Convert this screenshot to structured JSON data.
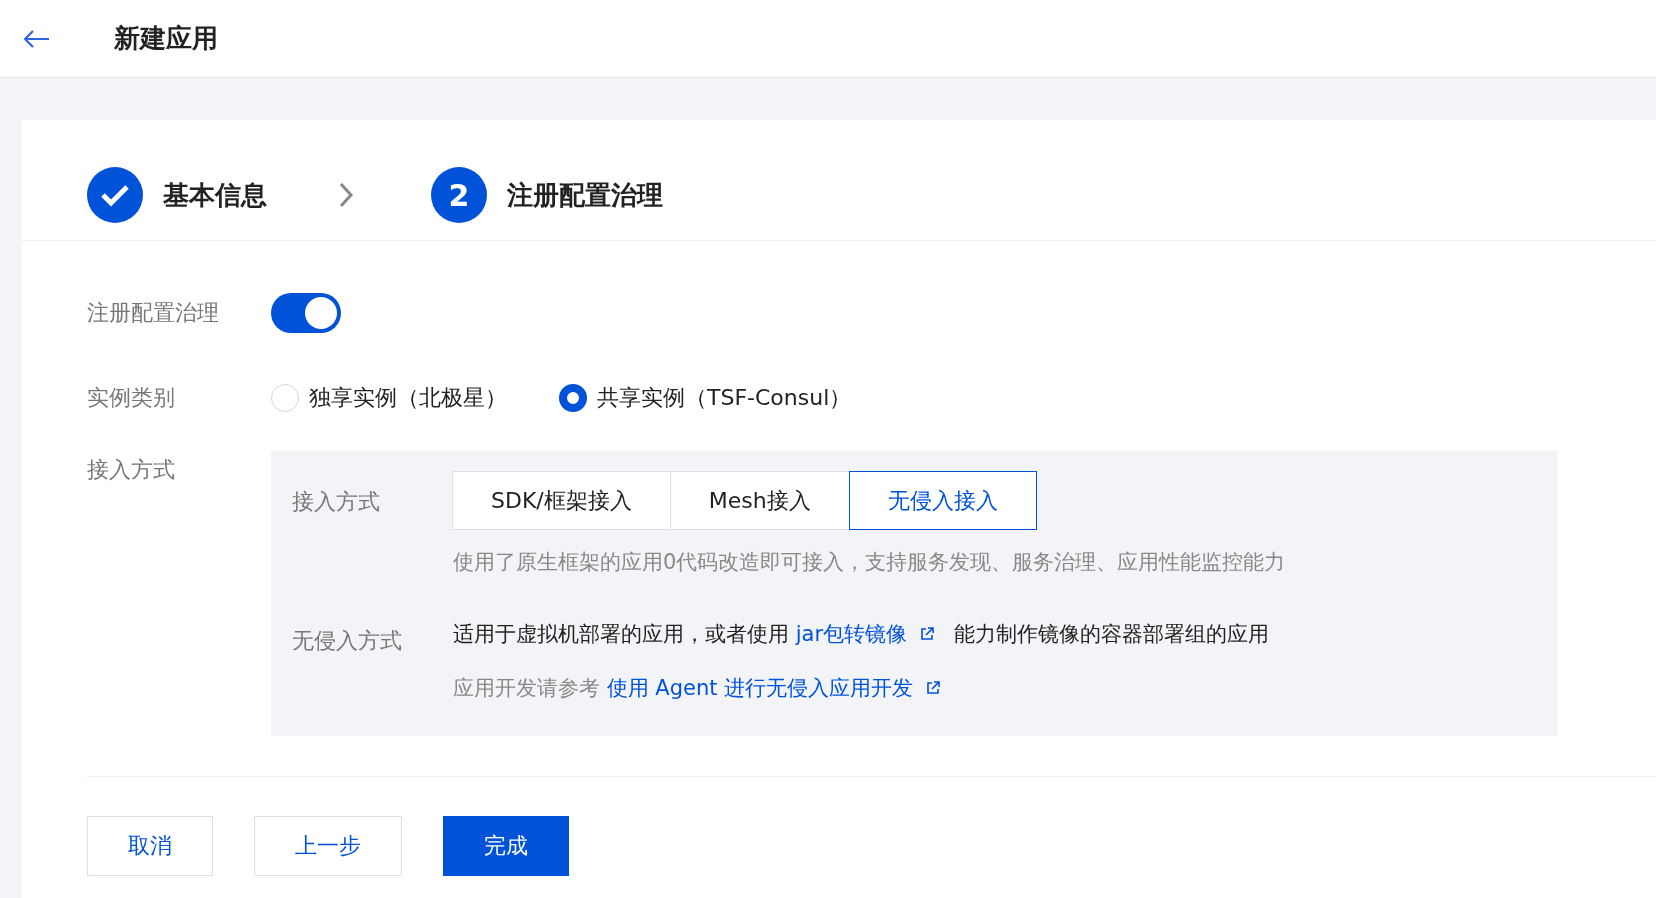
{
  "header": {
    "title": "新建应用"
  },
  "steps": [
    {
      "kind": "done",
      "label": "基本信息"
    },
    {
      "kind": "current",
      "number": "2",
      "label": "注册配置治理"
    }
  ],
  "registry": {
    "label": "注册配置治理",
    "on": true
  },
  "instance_type": {
    "label": "实例类别",
    "options": [
      {
        "label": "独享实例（北极星）",
        "selected": false
      },
      {
        "label": "共享实例（TSF-Consul）",
        "selected": true
      }
    ]
  },
  "access": {
    "label": "接入方式",
    "mode_label": "接入方式",
    "modes": [
      {
        "label": "SDK/框架接入",
        "selected": false
      },
      {
        "label": "Mesh接入",
        "selected": false
      },
      {
        "label": "无侵入接入",
        "selected": true
      }
    ],
    "mode_description": "使用了原生框架的应用0代码改造即可接入，支持服务发现、服务治理、应用性能监控能力",
    "detail_label": "无侵入方式",
    "detail_lines": [
      {
        "kind": "normal",
        "parts": [
          {
            "kind": "text",
            "text": "适用于虚拟机部署的应用，或者使用 "
          },
          {
            "kind": "link",
            "text": "jar包转镜像"
          },
          {
            "kind": "text",
            "text": " 能力制作镜像的容器部署组的应用"
          }
        ]
      },
      {
        "kind": "muted",
        "parts": [
          {
            "kind": "text",
            "text": "应用开发请参考 "
          },
          {
            "kind": "link",
            "text": "使用 Agent 进行无侵入应用开发"
          }
        ]
      }
    ]
  },
  "buttons": [
    {
      "label": "取消",
      "kind": "default"
    },
    {
      "label": "上一步",
      "kind": "default"
    },
    {
      "label": "完成",
      "kind": "primary"
    }
  ]
}
